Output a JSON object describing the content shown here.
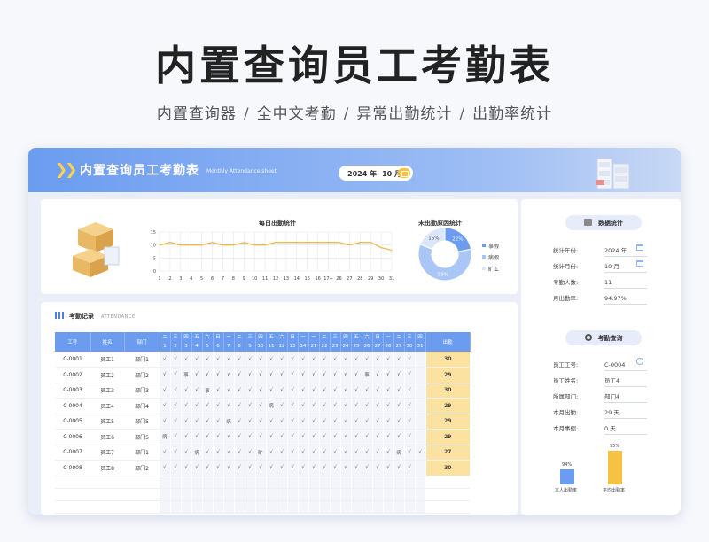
{
  "page": {
    "title": "内置查询员工考勤表",
    "subtitle_parts": [
      "内置查询器",
      "全中文考勤",
      "异常出勤统计",
      "出勤率统计"
    ],
    "separator": "/"
  },
  "header": {
    "title": "内置查询员工考勤表",
    "subtitle_en": "Monthly Attendance sheet",
    "year_label": "2024 年",
    "month_label": "10 月"
  },
  "colors": {
    "accent": "#6b9cf0",
    "gold": "#f5c242",
    "line": "#f0b94a",
    "pie_personal": "#6b9cf0",
    "pie_sick": "#a9c6f6",
    "pie_absent": "#dbe6fb"
  },
  "chart_data": [
    {
      "type": "line",
      "title": "每日出勤统计",
      "x": [
        "1",
        "2",
        "3",
        "4",
        "5",
        "6",
        "7",
        "8",
        "9",
        "10",
        "11",
        "12",
        "13",
        "14",
        "15",
        "16",
        "17+",
        "26",
        "27",
        "28",
        "29",
        "30",
        "31"
      ],
      "series": [
        {
          "values": [
            10,
            11,
            10,
            10,
            10,
            11,
            10,
            10,
            11,
            10,
            10,
            11,
            11,
            11,
            11,
            11,
            11,
            11,
            10,
            11,
            11,
            9,
            8
          ]
        }
      ],
      "ylim": [
        0,
        15
      ],
      "yticks": [
        0,
        5,
        10,
        15
      ],
      "grid": true
    },
    {
      "type": "pie",
      "title": "未出勤原因统计",
      "labels": [
        "事假",
        "病假",
        "旷工"
      ],
      "values": [
        22,
        59,
        19
      ],
      "value_labels": [
        "22%",
        "59%",
        "16%"
      ],
      "legend": "right"
    }
  ],
  "records": {
    "title": "考勤记录",
    "title_en": "ATTENDANCE",
    "columns": {
      "id": "工号",
      "name": "姓名",
      "dept": "部门",
      "total": "出勤"
    },
    "weekdays": [
      "二",
      "三",
      "四",
      "五",
      "六",
      "日",
      "一",
      "二",
      "三",
      "四",
      "五",
      "六",
      "日",
      "一",
      "一",
      "二",
      "三",
      "四",
      "五",
      "六",
      "日",
      "一",
      "二",
      "三",
      "四"
    ],
    "days": [
      "1",
      "2",
      "3",
      "4",
      "5",
      "6",
      "7",
      "8",
      "9",
      "10",
      "11",
      "12",
      "13",
      "14",
      "21",
      "22",
      "23",
      "24",
      "25",
      "26",
      "27",
      "28",
      "29",
      "30",
      "31"
    ],
    "rows": [
      {
        "id": "C-0001",
        "name": "员工1",
        "dept": "部门1",
        "marks": [
          "√",
          "√",
          "√",
          "√",
          "√",
          "√",
          "√",
          "√",
          "√",
          "√",
          "√",
          "√",
          "√",
          "√",
          "√",
          "√",
          "√",
          "√",
          "√",
          "√",
          "√",
          "√",
          "√",
          "√",
          ""
        ],
        "total": "30"
      },
      {
        "id": "C-0002",
        "name": "员工2",
        "dept": "部门2",
        "marks": [
          "√",
          "√",
          "事",
          "√",
          "√",
          "√",
          "√",
          "√",
          "√",
          "√",
          "√",
          "√",
          "√",
          "√",
          "√",
          "√",
          "√",
          "√",
          "√",
          "事",
          "√",
          "√",
          "√",
          "√",
          ""
        ],
        "total": "29"
      },
      {
        "id": "C-0003",
        "name": "员工3",
        "dept": "部门3",
        "marks": [
          "√",
          "√",
          "√",
          "√",
          "事",
          "√",
          "√",
          "√",
          "√",
          "√",
          "√",
          "√",
          "√",
          "√",
          "√",
          "√",
          "√",
          "√",
          "√",
          "√",
          "√",
          "√",
          "√",
          "√",
          ""
        ],
        "total": "30"
      },
      {
        "id": "C-0004",
        "name": "员工4",
        "dept": "部门4",
        "marks": [
          "√",
          "√",
          "√",
          "√",
          "√",
          "√",
          "√",
          "√",
          "√",
          "√",
          "病",
          "√",
          "√",
          "√",
          "√",
          "√",
          "√",
          "√",
          "√",
          "√",
          "√",
          "√",
          "√",
          "√",
          ""
        ],
        "total": "29"
      },
      {
        "id": "C-0005",
        "name": "员工5",
        "dept": "部门5",
        "marks": [
          "√",
          "√",
          "√",
          "√",
          "√",
          "√",
          "病",
          "√",
          "√",
          "√",
          "√",
          "√",
          "√",
          "√",
          "√",
          "√",
          "√",
          "√",
          "√",
          "√",
          "√",
          "√",
          "√",
          "√",
          ""
        ],
        "total": "29"
      },
      {
        "id": "C-0006",
        "name": "员工6",
        "dept": "部门5",
        "marks": [
          "病",
          "√",
          "√",
          "√",
          "√",
          "√",
          "√",
          "√",
          "√",
          "√",
          "√",
          "√",
          "√",
          "√",
          "√",
          "√",
          "√",
          "√",
          "√",
          "√",
          "√",
          "√",
          "√",
          "√",
          ""
        ],
        "total": "29"
      },
      {
        "id": "C-0007",
        "name": "员工7",
        "dept": "部门1",
        "marks": [
          "√",
          "√",
          "√",
          "病",
          "√",
          "√",
          "√",
          "√",
          "√",
          "旷",
          "√",
          "√",
          "√",
          "√",
          "√",
          "√",
          "√",
          "√",
          "√",
          "√",
          "√",
          "√",
          "病",
          "√",
          "√"
        ],
        "total": "27"
      },
      {
        "id": "C-0008",
        "name": "员工8",
        "dept": "部门2",
        "marks": [
          "√",
          "√",
          "√",
          "√",
          "√",
          "√",
          "√",
          "√",
          "√",
          "√",
          "√",
          "√",
          "√",
          "√",
          "√",
          "√",
          "√",
          "√",
          "√",
          "√",
          "√",
          "√",
          "√",
          "√",
          ""
        ],
        "total": "30"
      }
    ]
  },
  "stats": {
    "title": "数据统计",
    "rows": [
      {
        "label": "统计年份:",
        "value": "2024 年"
      },
      {
        "label": "统计月份:",
        "value": "10 月"
      },
      {
        "label": "考勤人数:",
        "value": "11"
      },
      {
        "label": "月出勤率:",
        "value": "94.97%"
      }
    ]
  },
  "query": {
    "title": "考勤查询",
    "rows": [
      {
        "label": "员工工号:",
        "value": "C-0004"
      },
      {
        "label": "员工姓名:",
        "value": "员工4"
      },
      {
        "label": "所属部门:",
        "value": "部门4"
      },
      {
        "label": "本月出勤:",
        "value": "29 天"
      },
      {
        "label": "本月事假:",
        "value": "0 天"
      }
    ],
    "bars": [
      {
        "label": "本人出勤率",
        "value_label": "94%",
        "value": 94,
        "color": "#6b9cf0"
      },
      {
        "label": "平均出勤率",
        "value_label": "95%",
        "value": 95,
        "color": "#f5c242"
      }
    ]
  }
}
